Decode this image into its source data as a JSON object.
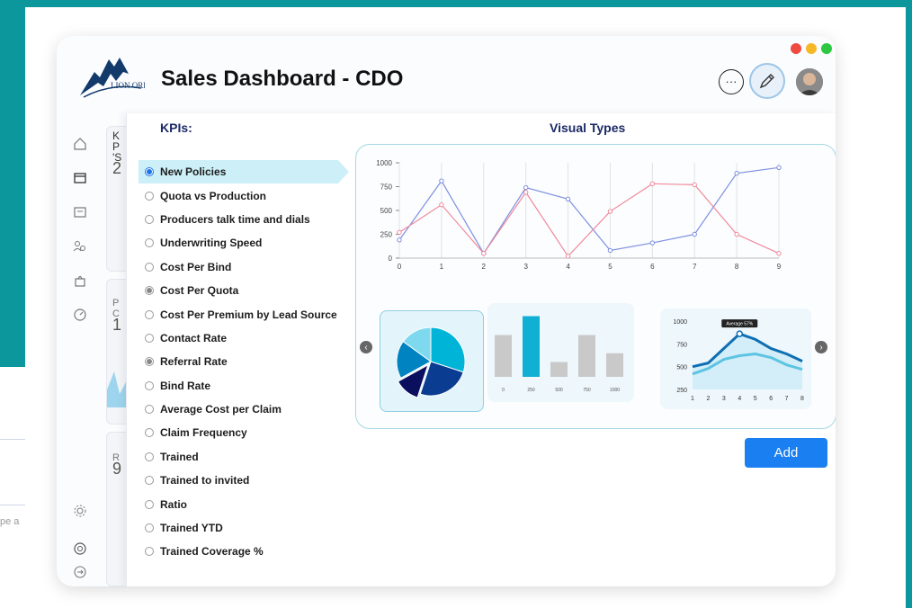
{
  "app": {
    "title": "Sales Dashboard - CDO",
    "logo_text": "LION ORBIT"
  },
  "window_dots": [
    "#f04a40",
    "#f5b827",
    "#2bc840"
  ],
  "header_icons": [
    "chat-icon",
    "pencil-icon",
    "avatar"
  ],
  "sidebar": {
    "items": [
      "home-icon",
      "archive-icon",
      "inbox-icon",
      "users-icon",
      "bag-icon",
      "gauge-icon"
    ],
    "bottom": [
      "settings-icon",
      "support-icon",
      "logout-icon"
    ]
  },
  "background_text": {
    "card1": [
      "K",
      "P",
      "'S",
      "2"
    ],
    "card2": [
      "P",
      "C",
      "1"
    ],
    "card3": [
      "R",
      "9"
    ],
    "left_placeholder": "pe a"
  },
  "panel": {
    "kpi_heading": "KPIs:",
    "visual_heading": "Visual Types",
    "add_label": "Add",
    "kpis": [
      {
        "label": "New Policies",
        "state": "selected"
      },
      {
        "label": "Quota vs Production",
        "state": "off"
      },
      {
        "label": "Producers talk time and dials",
        "state": "off"
      },
      {
        "label": "Underwriting Speed",
        "state": "off"
      },
      {
        "label": "Cost Per Bind",
        "state": "off"
      },
      {
        "label": "Cost Per Quota",
        "state": "gray"
      },
      {
        "label": "Cost Per Premium by Lead Source",
        "state": "off"
      },
      {
        "label": "Contact Rate",
        "state": "off"
      },
      {
        "label": "Referral Rate",
        "state": "gray"
      },
      {
        "label": "Bind Rate",
        "state": "off"
      },
      {
        "label": "Average Cost per Claim",
        "state": "off"
      },
      {
        "label": "Claim Frequency",
        "state": "off"
      },
      {
        "label": "Trained",
        "state": "off"
      },
      {
        "label": "Trained to invited",
        "state": "off"
      },
      {
        "label": "Ratio",
        "state": "off"
      },
      {
        "label": "Trained YTD",
        "state": "off"
      },
      {
        "label": "Trained Coverage %",
        "state": "off"
      }
    ]
  },
  "chart_data": [
    {
      "type": "line",
      "x": [
        0,
        1,
        2,
        3,
        4,
        5,
        6,
        7,
        8,
        9
      ],
      "series": [
        {
          "values": [
            190,
            810,
            50,
            740,
            620,
            80,
            160,
            250,
            890,
            950
          ],
          "color": "#7f8fe0"
        },
        {
          "values": [
            270,
            560,
            50,
            690,
            20,
            490,
            780,
            770,
            250,
            50
          ],
          "color": "#f08a9c"
        }
      ],
      "yticks": [
        0,
        250,
        500,
        750,
        1000
      ],
      "ylim": [
        0,
        1000
      ]
    },
    {
      "type": "pie",
      "values": [
        30,
        25,
        12,
        18,
        15
      ],
      "colors": [
        "#00b4d8",
        "#0a3d91",
        "#0a0f5e",
        "#0083c1",
        "#7fd9ee"
      ]
    },
    {
      "type": "bar",
      "categories": [
        "0",
        "250",
        "500",
        "750",
        "1000"
      ],
      "x_tick_labels": [
        "0",
        "250",
        "500",
        "750",
        "1000"
      ],
      "values": [
        0.62,
        0.9,
        0.22,
        0.62,
        0.35
      ],
      "colors": [
        "#c9c9c9",
        "#0fb0d4",
        "#c9c9c9",
        "#c9c9c9",
        "#c9c9c9"
      ]
    },
    {
      "type": "area",
      "x": [
        1,
        2,
        3,
        4,
        5,
        6,
        7,
        8
      ],
      "yticks": [
        250,
        500,
        750,
        1000
      ],
      "ylim": [
        250,
        1000
      ],
      "annotation": "Average 57%",
      "series": [
        {
          "values": [
            500,
            540,
            700,
            860,
            800,
            700,
            640,
            560
          ],
          "color": "#0f6fb3"
        },
        {
          "values": [
            420,
            480,
            580,
            620,
            640,
            600,
            520,
            470
          ],
          "color": "#5cc4e2"
        }
      ]
    }
  ]
}
